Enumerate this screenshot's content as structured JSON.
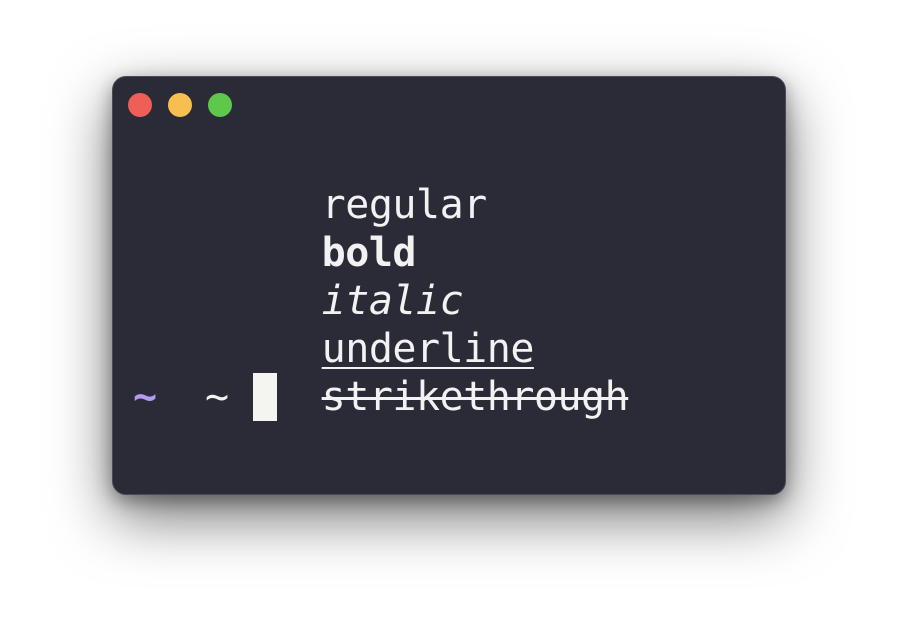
{
  "window": {
    "buttons": {
      "close_color": "#ee5f57",
      "minimize_color": "#f6bf4f",
      "maximize_color": "#5ec84b"
    },
    "background_color": "#2a2b36"
  },
  "terminal": {
    "lines": {
      "regular": "regular",
      "bold": "bold",
      "italic": "italic",
      "underline": "underline",
      "strikethrough": "strikethrough"
    },
    "prompt": {
      "symbol": "~",
      "symbol_color": "#b29cf2",
      "cwd": "~"
    },
    "cursor_color": "#f4f4f0"
  }
}
